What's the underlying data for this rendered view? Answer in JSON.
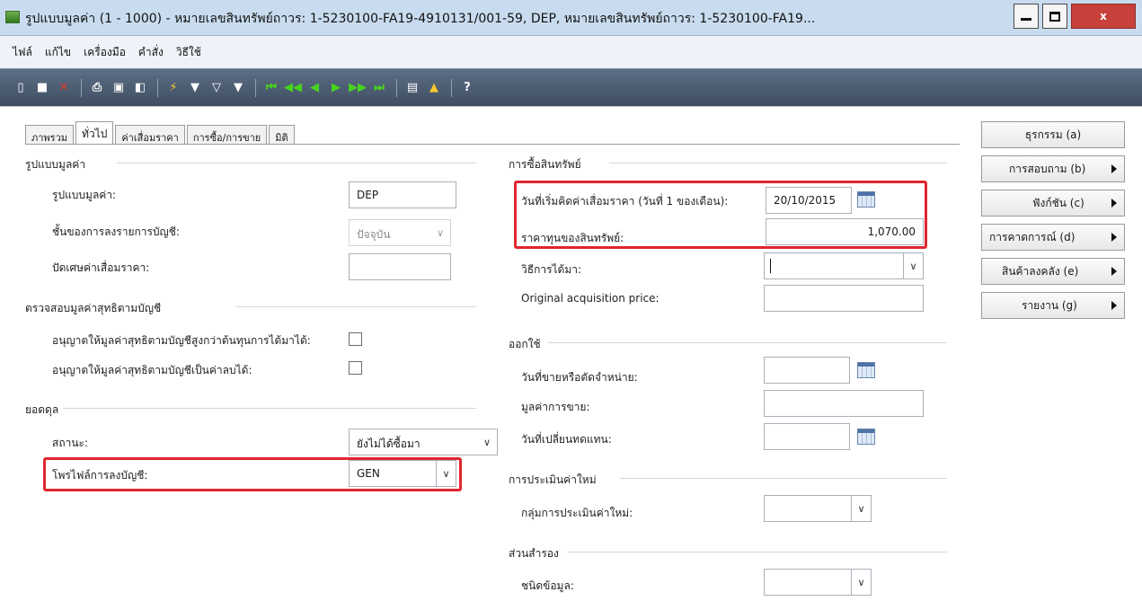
{
  "window": {
    "title": "รูปแบบมูลค่า (1 - 1000) - หมายเลขสินทรัพย์ถาวร: 1-5230100-FA19-4910131/001-59, DEP, หมายเลขสินทรัพย์ถาวร: 1-5230100-FA19...",
    "close_label": "x"
  },
  "menu": [
    "ไฟล์",
    "แก้ไข",
    "เครื่องมือ",
    "คำสั่ง",
    "วิธีใช้"
  ],
  "tabs": [
    "ภาพรวม",
    "ทั่วไป",
    "ค่าเสื่อมราคา",
    "การซื้อ/การขาย",
    "มิติ"
  ],
  "left": {
    "value_model": {
      "title": "รูปแบบมูลค่า",
      "model_label": "รูปแบบมูลค่า:",
      "model_value": "DEP",
      "posting_layer_label": "ชั้นของการลงรายการบัญชี:",
      "posting_layer_value": "ปัจจุบัน",
      "round_label": "ปัดเศษค่าเสื่อมราคา:",
      "round_value": ""
    },
    "nbv_check": {
      "title": "ตรวจสอบมูลค่าสุทธิตามบัญชี",
      "allow_higher_label": "อนุญาตให้มูลค่าสุทธิตามบัญชีสูงกว่าต้นทุนการได้มาได้:",
      "allow_negative_label": "อนุญาตให้มูลค่าสุทธิตามบัญชีเป็นค่าลบได้:"
    },
    "balance": {
      "title": "ยอดดุล",
      "status_label": "สถานะ:",
      "status_value": "ยังไม่ได้ซื้อมา",
      "posting_profile_label": "โพรไฟล์การลงบัญชี:",
      "posting_profile_value": "GEN"
    }
  },
  "middle": {
    "acquisition": {
      "title": "การซื้อสินทรัพย์",
      "dep_start_label": "วันที่เริ่มคิดค่าเสื่อมราคา (วันที่ 1 ของเดือน):",
      "dep_start_value": "20/10/2015",
      "cost_label": "ราคาทุนของสินทรัพย์:",
      "cost_value": "1,070.00",
      "method_label": "วิธีการได้มา:",
      "method_value": "",
      "orig_price_label": "Original acquisition price:",
      "orig_price_value": ""
    },
    "disposal": {
      "title": "ออกใช้",
      "sale_date_label": "วันที่ขายหรือตัดจำหน่าย:",
      "sale_value_label": "มูลค่าการขาย:",
      "replace_date_label": "วันที่เปลี่ยนทดแทน:"
    },
    "revaluation": {
      "title": "การประเมินค่าใหม่",
      "group_label": "กลุ่มการประเมินค่าใหม่:"
    },
    "reserve": {
      "title": "ส่วนสำรอง",
      "type_label": "ชนิดข้อมูล:"
    }
  },
  "side_buttons": [
    "ธุรกรรม (a)",
    "การสอบถาม (b)",
    "ฟังก์ชัน (c)",
    "การคาดการณ์ (d)",
    "สินค้าลงคลัง (e)",
    "รายงาน (g)"
  ]
}
